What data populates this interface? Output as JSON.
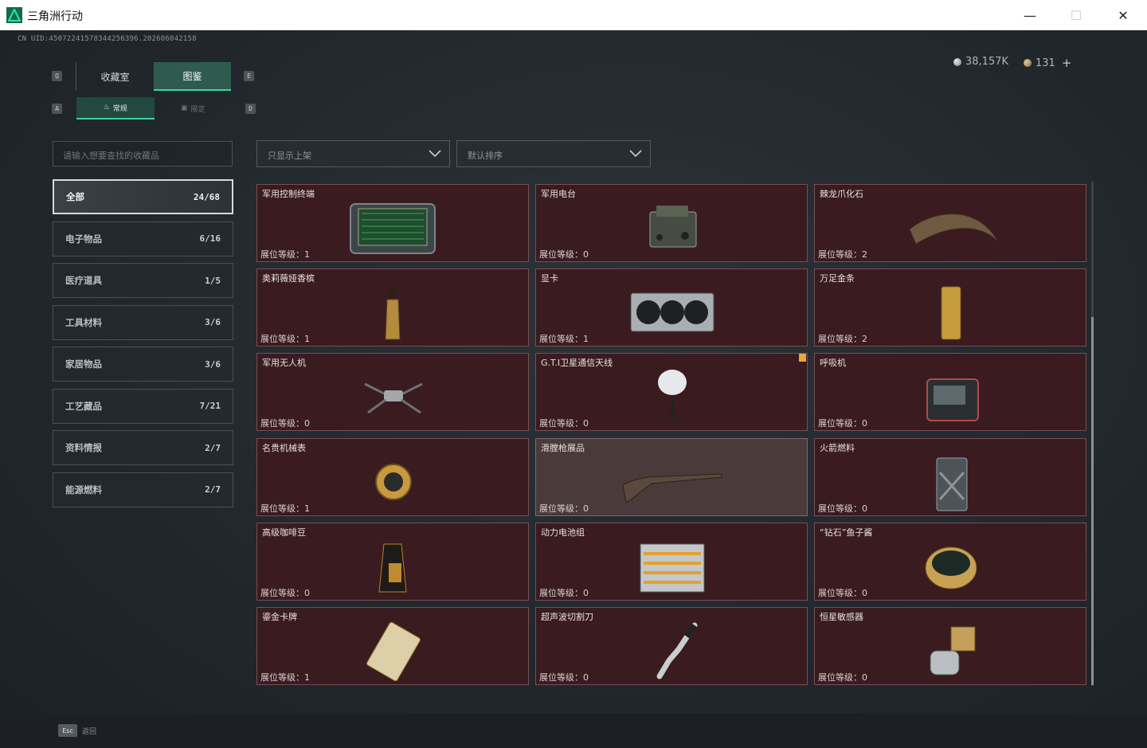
{
  "window": {
    "title": "三角洲行动",
    "minimize": "—",
    "maximize": "☐",
    "close": "✕"
  },
  "uid": "CN UID:4507224157834425639​6.202606042158",
  "currency": {
    "silver": "38,157K",
    "gold": "131",
    "plus": "+"
  },
  "keys": {
    "q": "Q",
    "e": "E",
    "a": "A",
    "d": "D"
  },
  "tabs": {
    "collection": "收藏室",
    "gallery": "图鉴"
  },
  "subtabs": {
    "normal": "常规",
    "limited": "限定"
  },
  "search": {
    "placeholder": "请输入想要查找的收藏品"
  },
  "filters": {
    "shelf": "只显示上架",
    "sort": "默认排序"
  },
  "categories": [
    {
      "label": "全部",
      "count": "24/68"
    },
    {
      "label": "电子物品",
      "count": "6/16"
    },
    {
      "label": "医疗道具",
      "count": "1/5"
    },
    {
      "label": "工具材料",
      "count": "3/6"
    },
    {
      "label": "家居物品",
      "count": "3/6"
    },
    {
      "label": "工艺藏品",
      "count": "7/21"
    },
    {
      "label": "资料情报",
      "count": "2/7"
    },
    {
      "label": "能源燃料",
      "count": "2/7"
    }
  ],
  "items": [
    {
      "name": "军用控制终端",
      "level": "展位等级：1",
      "icon": "terminal-icon"
    },
    {
      "name": "军用电台",
      "level": "展位等级：0",
      "icon": "radio-icon"
    },
    {
      "name": "棘龙爪化石",
      "level": "展位等级：2",
      "icon": "claw-fossil-icon"
    },
    {
      "name": "奥莉薇娅香槟",
      "level": "展位等级：1",
      "icon": "champagne-icon"
    },
    {
      "name": "显卡",
      "level": "展位等级：1",
      "icon": "gpu-icon"
    },
    {
      "name": "万足金条",
      "level": "展位等级：2",
      "icon": "gold-bar-icon"
    },
    {
      "name": "军用无人机",
      "level": "展位等级：0",
      "icon": "drone-icon"
    },
    {
      "name": "G.T.I卫星通信天线",
      "level": "展位等级：0",
      "icon": "satellite-dish-icon"
    },
    {
      "name": "呼吸机",
      "level": "展位等级：0",
      "icon": "ventilator-icon"
    },
    {
      "name": "名贵机械表",
      "level": "展位等级：1",
      "icon": "watch-icon"
    },
    {
      "name": "滑膛枪展品",
      "level": "展位等级：0",
      "icon": "musket-icon"
    },
    {
      "name": "火箭燃料",
      "level": "展位等级：0",
      "icon": "fuel-can-icon"
    },
    {
      "name": "高级咖啡豆",
      "level": "展位等级：0",
      "icon": "coffee-bag-icon"
    },
    {
      "name": "动力电池组",
      "level": "展位等级：0",
      "icon": "battery-pack-icon"
    },
    {
      "name": "“钻石”鱼子酱",
      "level": "展位等级：0",
      "icon": "caviar-tin-icon"
    },
    {
      "name": "鎏金卡牌",
      "level": "展位等级：1",
      "icon": "gold-card-icon"
    },
    {
      "name": "超声波切割刀",
      "level": "展位等级：0",
      "icon": "ultrasonic-knife-icon"
    },
    {
      "name": "恒星敏感器",
      "level": "展位等级：0",
      "icon": "star-sensor-icon"
    }
  ],
  "footer": {
    "key": "Esc",
    "label": "返回"
  }
}
